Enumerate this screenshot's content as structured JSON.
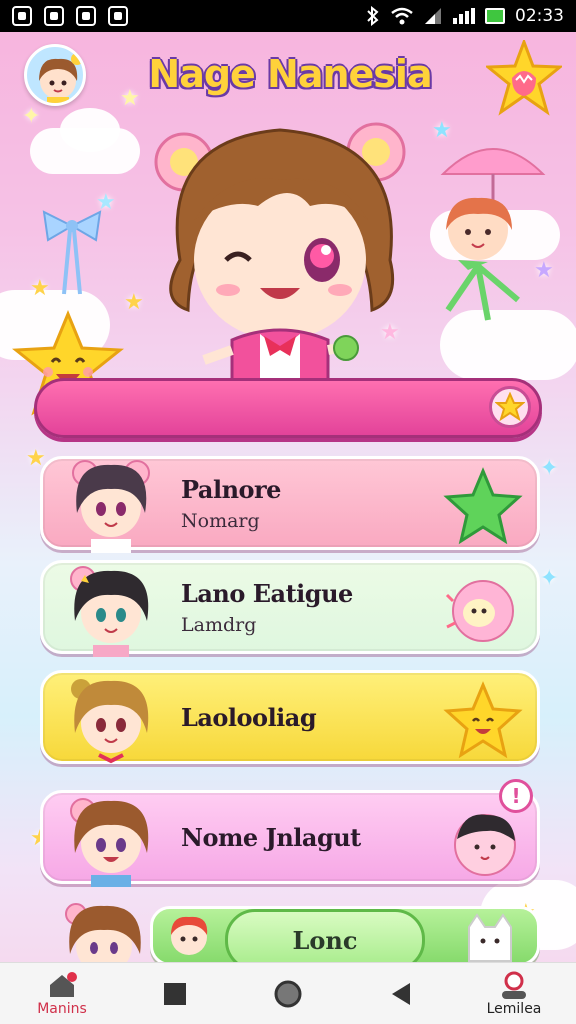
{
  "status_bar": {
    "time": "02:33"
  },
  "header": {
    "title": "Nage Nanesia"
  },
  "menu_items": [
    {
      "name": "Palnore",
      "sub": "Nomarg"
    },
    {
      "name": "Lano Eatigue",
      "sub": "Lamdrg"
    },
    {
      "name": "Laolooliag",
      "sub": ""
    },
    {
      "name": "Nome Jnlagut",
      "sub": "",
      "badge": "!"
    }
  ],
  "bottom_button": {
    "label": "Lonc"
  },
  "navbar": {
    "left_label": "Manins",
    "right_label": "Lemilea"
  },
  "colors": {
    "accent_pink": "#e3439a",
    "title_yellow": "#ffd23a",
    "title_outline": "#6a3aa6"
  },
  "icons": {
    "status_left": [
      "gallery-icon",
      "mask-icon",
      "bag-icon",
      "camera-icon"
    ],
    "status_right": [
      "bluetooth-icon",
      "wifi-icon",
      "signal-icon",
      "battery-icon"
    ],
    "nav": [
      "home-icon",
      "square-icon",
      "circle-icon",
      "back-icon",
      "profile-icon"
    ]
  }
}
